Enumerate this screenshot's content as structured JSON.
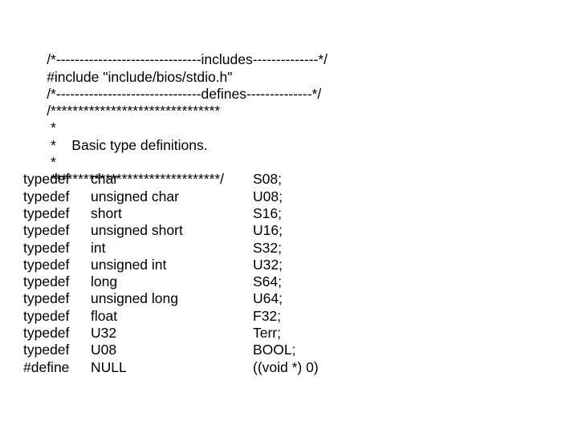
{
  "document": {
    "kind": "source-code-listing",
    "language": "C",
    "background_color": "#ffffff",
    "text_color": "#000000"
  },
  "code": {
    "includes_banner": "/*-------------------------------includes--------------*/",
    "include_directive": "#include \"include/bios/stdio.h\"",
    "defines_banner": "/*-------------------------------defines--------------*/",
    "comment_block": {
      "open": "/*******************************",
      "line_blank_top": " *",
      "line_title": " *    Basic type definitions.",
      "line_blank_bottom": " *",
      "close": " *******************************/"
    },
    "declarations": [
      {
        "keyword": "typedef",
        "basetype": "char",
        "alias": "S08;"
      },
      {
        "keyword": "typedef",
        "basetype": "unsigned char",
        "alias": "U08;"
      },
      {
        "keyword": "typedef",
        "basetype": "short",
        "alias": "S16;"
      },
      {
        "keyword": "typedef",
        "basetype": "unsigned short",
        "alias": "U16;"
      },
      {
        "keyword": "typedef",
        "basetype": "int",
        "alias": "S32;"
      },
      {
        "keyword": "typedef",
        "basetype": "unsigned int",
        "alias": "U32;"
      },
      {
        "keyword": "typedef",
        "basetype": "long",
        "alias": "S64;"
      },
      {
        "keyword": "typedef",
        "basetype": "unsigned long",
        "alias": "U64;"
      },
      {
        "keyword": "typedef",
        "basetype": "float",
        "alias": "F32;"
      },
      {
        "keyword": "typedef",
        "basetype": "U32",
        "alias": "Terr;"
      },
      {
        "keyword": "typedef",
        "basetype": "U08",
        "alias": "BOOL;"
      },
      {
        "keyword": "#define",
        "basetype": "NULL",
        "alias": "((void *) 0)"
      }
    ]
  }
}
